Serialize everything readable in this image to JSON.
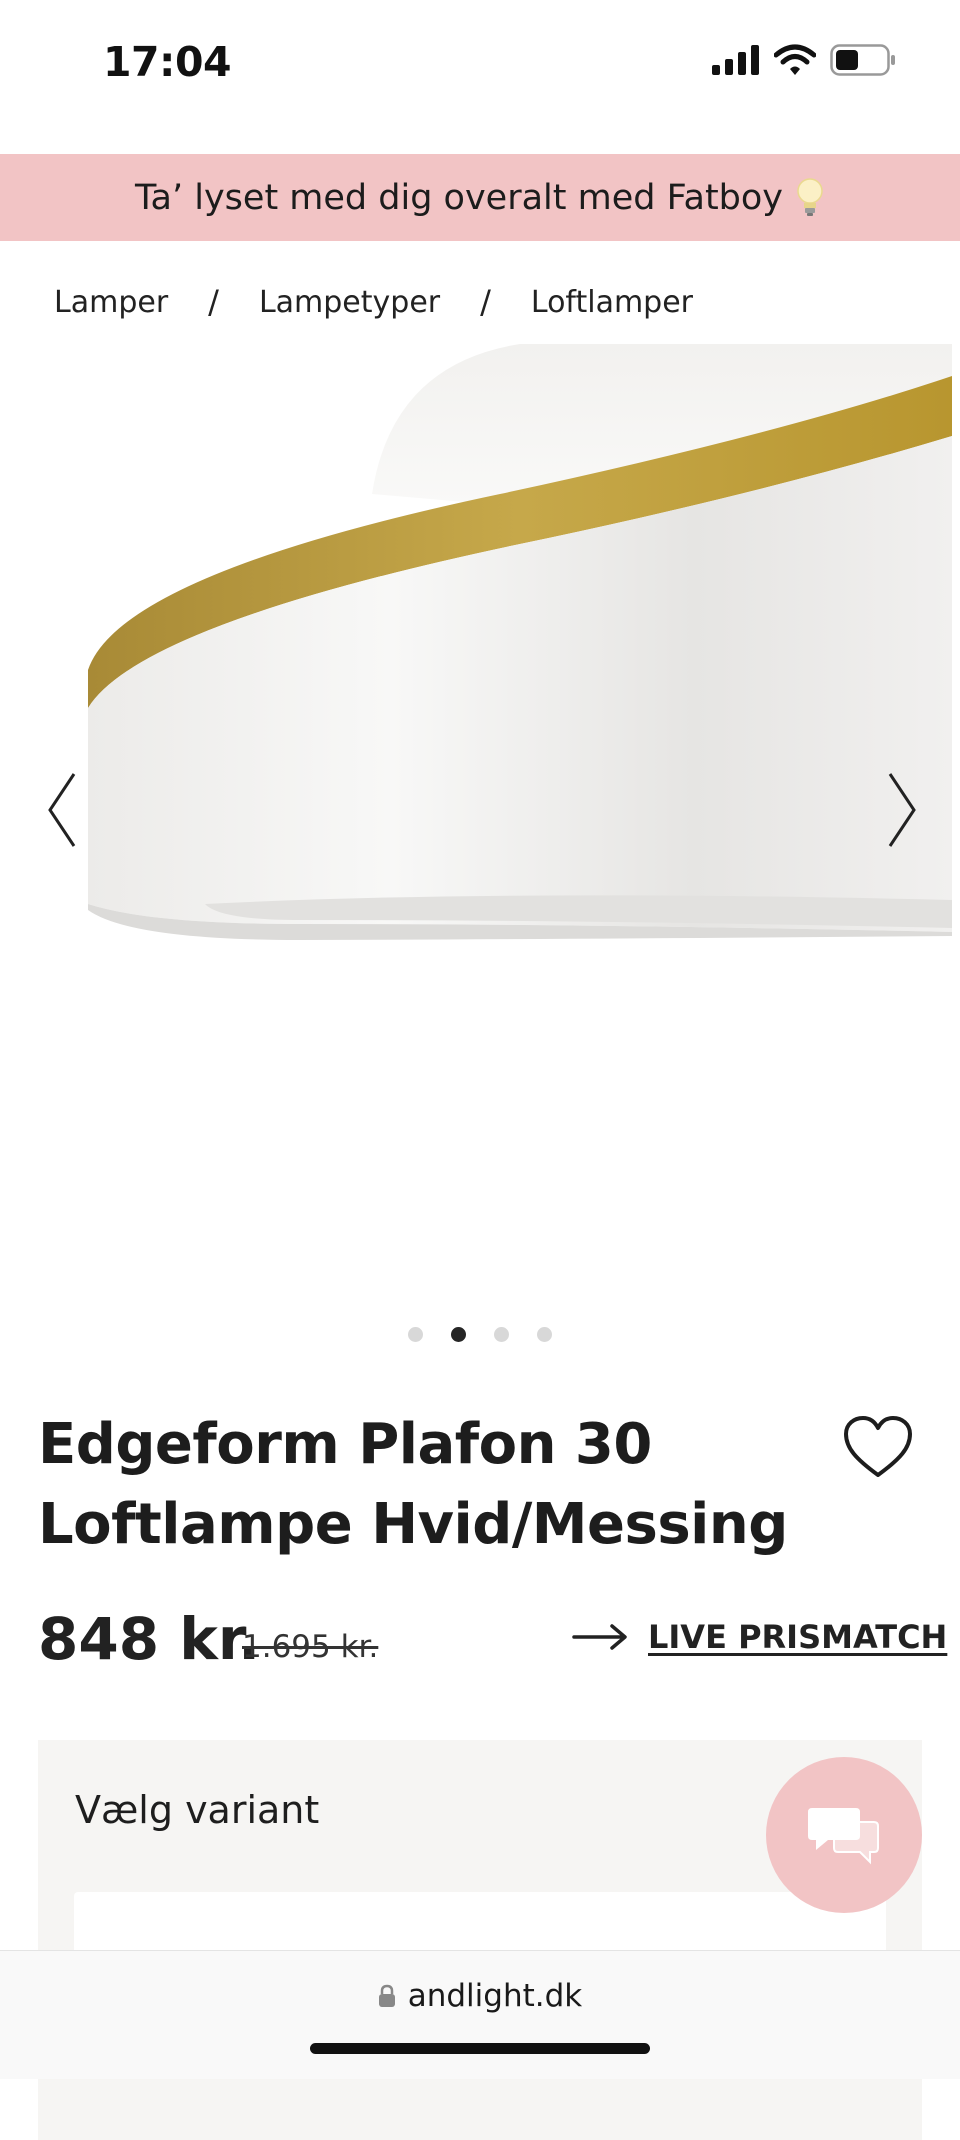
{
  "status_bar": {
    "time": "17:04"
  },
  "promo": {
    "text": "Ta’ lyset med dig overalt med Fatboy"
  },
  "breadcrumb": {
    "items": [
      "Lamper",
      "Lampetyper",
      "Loftlamper"
    ],
    "separator": "/"
  },
  "gallery": {
    "slide_count": 4,
    "active_slide": 2
  },
  "product": {
    "title_line1": "Edgeform Plafon 30",
    "title_line2": "Loftlampe Hvid/Messing",
    "price": "848 kr.",
    "old_price": "1.695 kr.",
    "prismatch_label": "LIVE PRISMATCH"
  },
  "variant": {
    "heading": "Vælg variant"
  },
  "browser": {
    "url": "andlight.dk"
  },
  "colors": {
    "banner": "#f2c4c5",
    "brass": "#b8962f",
    "text": "#1d1d1d"
  }
}
